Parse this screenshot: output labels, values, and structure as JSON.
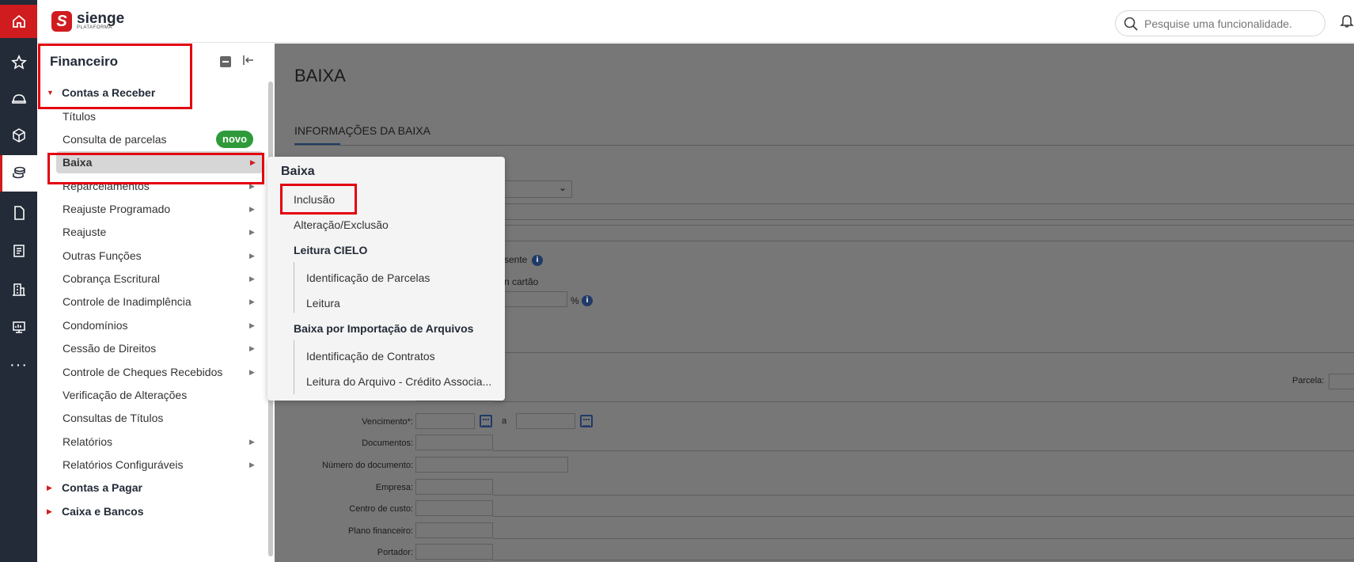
{
  "rail": {
    "items": [
      "home-icon",
      "star-icon",
      "hardhat-icon",
      "box-icon",
      "coins-icon",
      "document-icon",
      "report-icon",
      "building-icon",
      "monitor-icon",
      "more-icon"
    ]
  },
  "header": {
    "logo_text": "sienge",
    "logo_sub": "PLATAFORMA",
    "search_placeholder": "Pesquise uma funcionalidade."
  },
  "sidebar": {
    "title": "Financeiro",
    "group_receber": "Contas a Receber",
    "items": [
      {
        "label": "Títulos"
      },
      {
        "label": "Consulta de parcelas",
        "badge": "novo"
      },
      {
        "label": "Baixa"
      },
      {
        "label": "Reparcelamentos"
      },
      {
        "label": "Reajuste Programado"
      },
      {
        "label": "Reajuste"
      },
      {
        "label": "Outras Funções"
      },
      {
        "label": "Cobrança Escritural"
      },
      {
        "label": "Controle de Inadimplência"
      },
      {
        "label": "Condomínios"
      },
      {
        "label": "Cessão de Direitos"
      },
      {
        "label": "Controle de Cheques Recebidos"
      },
      {
        "label": "Verificação de Alterações"
      },
      {
        "label": "Consultas de Títulos"
      },
      {
        "label": "Relatórios"
      },
      {
        "label": "Relatórios Configuráveis"
      }
    ],
    "group_pagar": "Contas a Pagar",
    "group_caixa": "Caixa e Bancos"
  },
  "content": {
    "title": "BAIXA",
    "tab": "INFORMAÇÕES DA BAIXA",
    "partial_text_1": "sente",
    "partial_text_2": "n cartão",
    "percent": "%",
    "parcela_label": "Parcela:",
    "date_sep": "a",
    "labels": {
      "vencimento": "Vencimento*:",
      "documentos": "Documentos:",
      "numero_documento": "Número do documento:",
      "empresa": "Empresa:",
      "centro_custo": "Centro de custo:",
      "plano_financeiro": "Plano financeiro:",
      "portador": "Portador:"
    }
  },
  "flyout": {
    "title": "Baixa",
    "inclusao": "Inclusão",
    "alteracao": "Alteração/Exclusão",
    "cielo_head": "Leitura CIELO",
    "cielo_items": [
      "Identificação de Parcelas",
      "Leitura"
    ],
    "importacao_head": "Baixa por Importação de Arquivos",
    "importacao_items": [
      "Identificação de Contratos",
      "Leitura do Arquivo - Crédito Associa..."
    ]
  }
}
